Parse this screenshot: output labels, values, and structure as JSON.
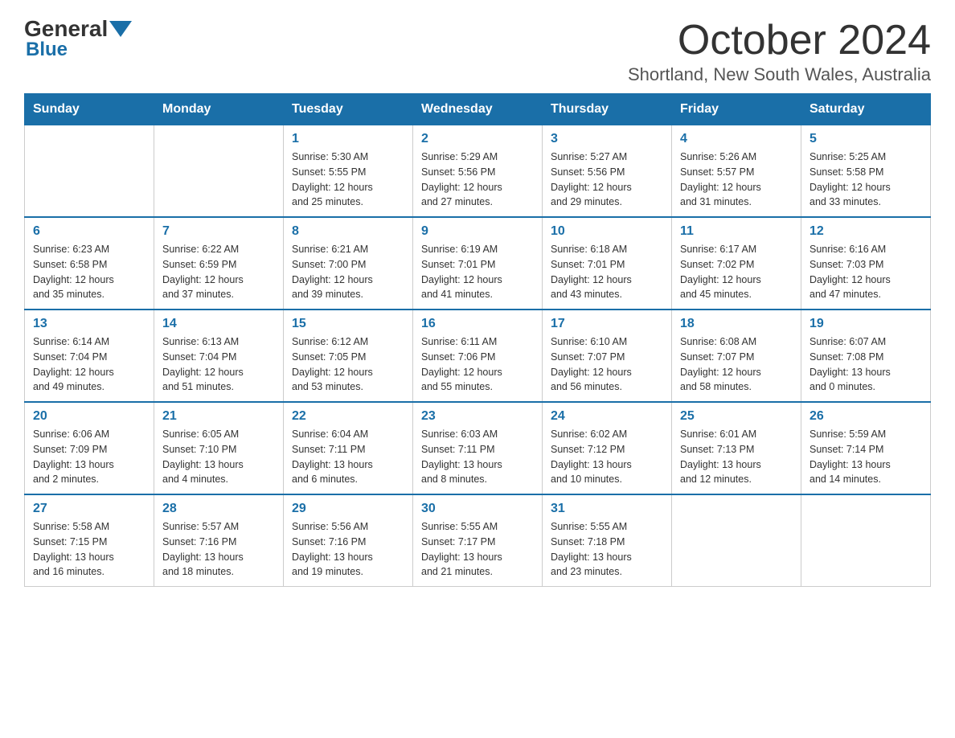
{
  "logo": {
    "general": "General",
    "blue": "Blue"
  },
  "title": "October 2024",
  "location": "Shortland, New South Wales, Australia",
  "weekdays": [
    "Sunday",
    "Monday",
    "Tuesday",
    "Wednesday",
    "Thursday",
    "Friday",
    "Saturday"
  ],
  "weeks": [
    [
      {
        "day": "",
        "info": ""
      },
      {
        "day": "",
        "info": ""
      },
      {
        "day": "1",
        "info": "Sunrise: 5:30 AM\nSunset: 5:55 PM\nDaylight: 12 hours\nand 25 minutes."
      },
      {
        "day": "2",
        "info": "Sunrise: 5:29 AM\nSunset: 5:56 PM\nDaylight: 12 hours\nand 27 minutes."
      },
      {
        "day": "3",
        "info": "Sunrise: 5:27 AM\nSunset: 5:56 PM\nDaylight: 12 hours\nand 29 minutes."
      },
      {
        "day": "4",
        "info": "Sunrise: 5:26 AM\nSunset: 5:57 PM\nDaylight: 12 hours\nand 31 minutes."
      },
      {
        "day": "5",
        "info": "Sunrise: 5:25 AM\nSunset: 5:58 PM\nDaylight: 12 hours\nand 33 minutes."
      }
    ],
    [
      {
        "day": "6",
        "info": "Sunrise: 6:23 AM\nSunset: 6:58 PM\nDaylight: 12 hours\nand 35 minutes."
      },
      {
        "day": "7",
        "info": "Sunrise: 6:22 AM\nSunset: 6:59 PM\nDaylight: 12 hours\nand 37 minutes."
      },
      {
        "day": "8",
        "info": "Sunrise: 6:21 AM\nSunset: 7:00 PM\nDaylight: 12 hours\nand 39 minutes."
      },
      {
        "day": "9",
        "info": "Sunrise: 6:19 AM\nSunset: 7:01 PM\nDaylight: 12 hours\nand 41 minutes."
      },
      {
        "day": "10",
        "info": "Sunrise: 6:18 AM\nSunset: 7:01 PM\nDaylight: 12 hours\nand 43 minutes."
      },
      {
        "day": "11",
        "info": "Sunrise: 6:17 AM\nSunset: 7:02 PM\nDaylight: 12 hours\nand 45 minutes."
      },
      {
        "day": "12",
        "info": "Sunrise: 6:16 AM\nSunset: 7:03 PM\nDaylight: 12 hours\nand 47 minutes."
      }
    ],
    [
      {
        "day": "13",
        "info": "Sunrise: 6:14 AM\nSunset: 7:04 PM\nDaylight: 12 hours\nand 49 minutes."
      },
      {
        "day": "14",
        "info": "Sunrise: 6:13 AM\nSunset: 7:04 PM\nDaylight: 12 hours\nand 51 minutes."
      },
      {
        "day": "15",
        "info": "Sunrise: 6:12 AM\nSunset: 7:05 PM\nDaylight: 12 hours\nand 53 minutes."
      },
      {
        "day": "16",
        "info": "Sunrise: 6:11 AM\nSunset: 7:06 PM\nDaylight: 12 hours\nand 55 minutes."
      },
      {
        "day": "17",
        "info": "Sunrise: 6:10 AM\nSunset: 7:07 PM\nDaylight: 12 hours\nand 56 minutes."
      },
      {
        "day": "18",
        "info": "Sunrise: 6:08 AM\nSunset: 7:07 PM\nDaylight: 12 hours\nand 58 minutes."
      },
      {
        "day": "19",
        "info": "Sunrise: 6:07 AM\nSunset: 7:08 PM\nDaylight: 13 hours\nand 0 minutes."
      }
    ],
    [
      {
        "day": "20",
        "info": "Sunrise: 6:06 AM\nSunset: 7:09 PM\nDaylight: 13 hours\nand 2 minutes."
      },
      {
        "day": "21",
        "info": "Sunrise: 6:05 AM\nSunset: 7:10 PM\nDaylight: 13 hours\nand 4 minutes."
      },
      {
        "day": "22",
        "info": "Sunrise: 6:04 AM\nSunset: 7:11 PM\nDaylight: 13 hours\nand 6 minutes."
      },
      {
        "day": "23",
        "info": "Sunrise: 6:03 AM\nSunset: 7:11 PM\nDaylight: 13 hours\nand 8 minutes."
      },
      {
        "day": "24",
        "info": "Sunrise: 6:02 AM\nSunset: 7:12 PM\nDaylight: 13 hours\nand 10 minutes."
      },
      {
        "day": "25",
        "info": "Sunrise: 6:01 AM\nSunset: 7:13 PM\nDaylight: 13 hours\nand 12 minutes."
      },
      {
        "day": "26",
        "info": "Sunrise: 5:59 AM\nSunset: 7:14 PM\nDaylight: 13 hours\nand 14 minutes."
      }
    ],
    [
      {
        "day": "27",
        "info": "Sunrise: 5:58 AM\nSunset: 7:15 PM\nDaylight: 13 hours\nand 16 minutes."
      },
      {
        "day": "28",
        "info": "Sunrise: 5:57 AM\nSunset: 7:16 PM\nDaylight: 13 hours\nand 18 minutes."
      },
      {
        "day": "29",
        "info": "Sunrise: 5:56 AM\nSunset: 7:16 PM\nDaylight: 13 hours\nand 19 minutes."
      },
      {
        "day": "30",
        "info": "Sunrise: 5:55 AM\nSunset: 7:17 PM\nDaylight: 13 hours\nand 21 minutes."
      },
      {
        "day": "31",
        "info": "Sunrise: 5:55 AM\nSunset: 7:18 PM\nDaylight: 13 hours\nand 23 minutes."
      },
      {
        "day": "",
        "info": ""
      },
      {
        "day": "",
        "info": ""
      }
    ]
  ]
}
